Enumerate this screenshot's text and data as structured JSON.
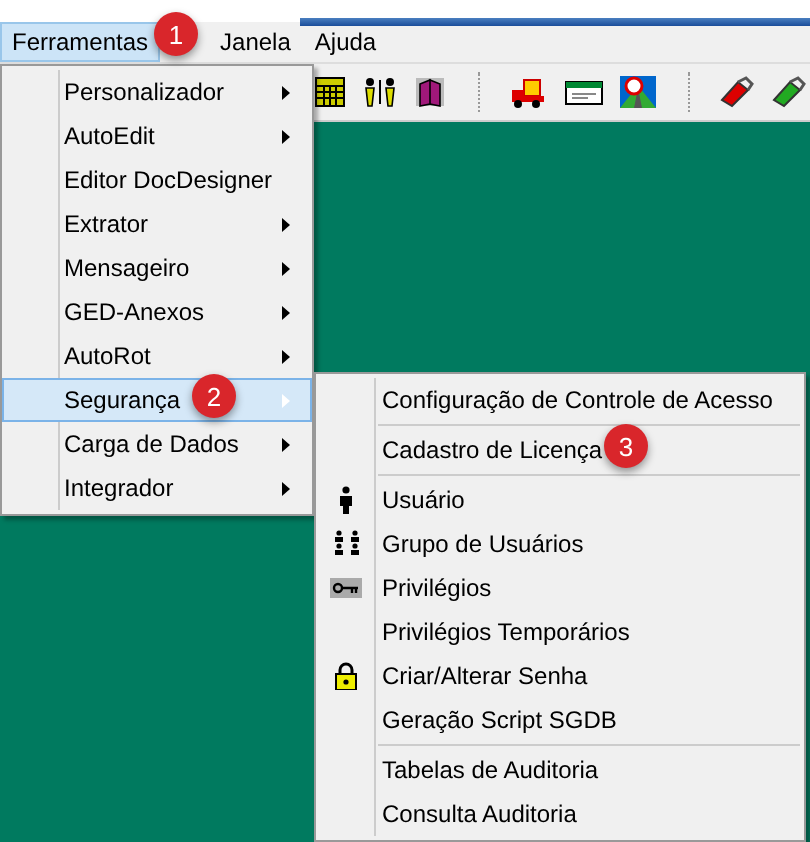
{
  "menubar": [
    {
      "label": "Ferramentas",
      "selected": true
    },
    {
      "label": "Janela",
      "selected": false
    },
    {
      "label": "Ajuda",
      "selected": false
    }
  ],
  "menu": [
    {
      "label": "Personalizador",
      "has_submenu": true,
      "selected": false
    },
    {
      "label": "AutoEdit",
      "has_submenu": true,
      "selected": false
    },
    {
      "label": "Editor DocDesigner",
      "has_submenu": false,
      "selected": false
    },
    {
      "label": "Extrator",
      "has_submenu": true,
      "selected": false
    },
    {
      "label": "Mensageiro",
      "has_submenu": true,
      "selected": false
    },
    {
      "label": "GED-Anexos",
      "has_submenu": true,
      "selected": false
    },
    {
      "label": "AutoRot",
      "has_submenu": true,
      "selected": false
    },
    {
      "label": "Segurança",
      "has_submenu": true,
      "selected": true
    },
    {
      "label": "Carga de Dados",
      "has_submenu": true,
      "selected": false
    },
    {
      "label": "Integrador",
      "has_submenu": true,
      "selected": false
    }
  ],
  "submenu": [
    {
      "label": "Configuração de Controle de Acesso",
      "kind": "plain",
      "separator_before": false
    },
    {
      "label": "Cadastro de Licença",
      "kind": "plain",
      "separator_before": true
    },
    {
      "label": "Usuário",
      "kind": "user",
      "separator_before": true
    },
    {
      "label": "Grupo de Usuários",
      "kind": "group",
      "separator_before": false
    },
    {
      "label": "Privilégios",
      "kind": "key",
      "separator_before": false
    },
    {
      "label": "Privilégios Temporários",
      "kind": "plain",
      "separator_before": false
    },
    {
      "label": "Criar/Alterar Senha",
      "kind": "lock",
      "separator_before": false
    },
    {
      "label": "Geração Script SGDB",
      "kind": "plain",
      "separator_before": false
    },
    {
      "label": "Tabelas de Auditoria",
      "kind": "plain",
      "separator_before": true
    },
    {
      "label": "Consulta Auditoria",
      "kind": "plain",
      "separator_before": false
    }
  ],
  "callouts": [
    "1",
    "2",
    "3"
  ]
}
